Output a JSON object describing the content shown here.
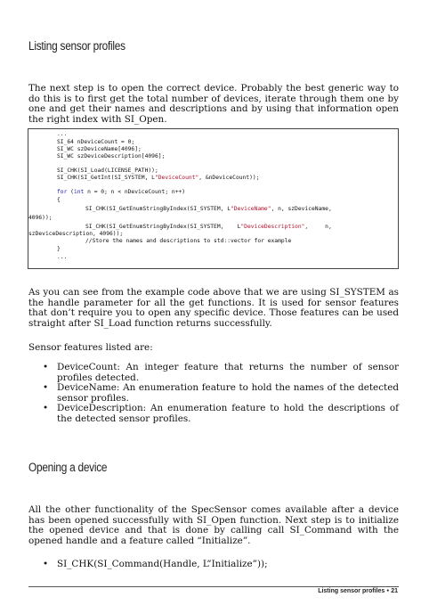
{
  "section1": {
    "heading": "Listing sensor profiles",
    "intro": "The next step is to open the correct device. Probably the best generic way to do this is to first get the total number of devices, iterate through them one by one and get their names and descriptions and by using that information open the right index with SI_Open.",
    "code_lines": [
      "...",
      "SI_64 nDeviceCount = 0;",
      "SI_WC szDeviceName[4096];",
      "SI_WC szDeviceDescription[4096];",
      "",
      "SI_CHK(SI_Load(LICENSE_PATH));",
      "SI_CHK(SI_GetInt(SI_SYSTEM, L\"DeviceCount\", &nDeviceCount));",
      "",
      "for (int n = 0; n < nDeviceCount; n++)",
      "{",
      "SI_CHK(SI_GetEnumStringByIndex(SI_SYSTEM, L\"DeviceName\", n, szDeviceName,",
      "4096));",
      "SI_CHK(SI_GetEnumStringByIndex(SI_SYSTEM, L\"DeviceDescription\", n,",
      "szDeviceDescription, 4096));",
      "//Store the names and descriptions to std::vector for example",
      "}",
      "..."
    ],
    "after_code": "As you can see from the example code above that we are using SI_SYSTEM as the handle parameter for all the get functions. It is used for sensor features that don’t require you to open any specific device. Those features can be used straight after SI_Load function returns successfully.",
    "features_title": "Sensor features listed are:",
    "bullets": [
      "DeviceCount: An integer feature that returns the number of sensor profiles detected.",
      "DeviceName: An enumeration feature to hold the names of the detected sensor profiles.",
      "DeviceDescription: An enumeration feature to hold the descriptions of the detected sensor profiles."
    ]
  },
  "section2": {
    "heading": "Opening a device",
    "para": "All the other functionality of the SpecSensor comes available after a device has been opened successfully with SI_Open function. Next step is to initialize the opened device and that is done by calling call SI_Command with the opened handle and a feature called “Initialize”.",
    "bullets": [
      "SI_CHK(SI_Command(Handle, L”Initialize”));"
    ]
  },
  "footer": {
    "text": "Listing sensor profiles",
    "bullet": "●",
    "page": "21"
  },
  "bullet_glyph": "•"
}
